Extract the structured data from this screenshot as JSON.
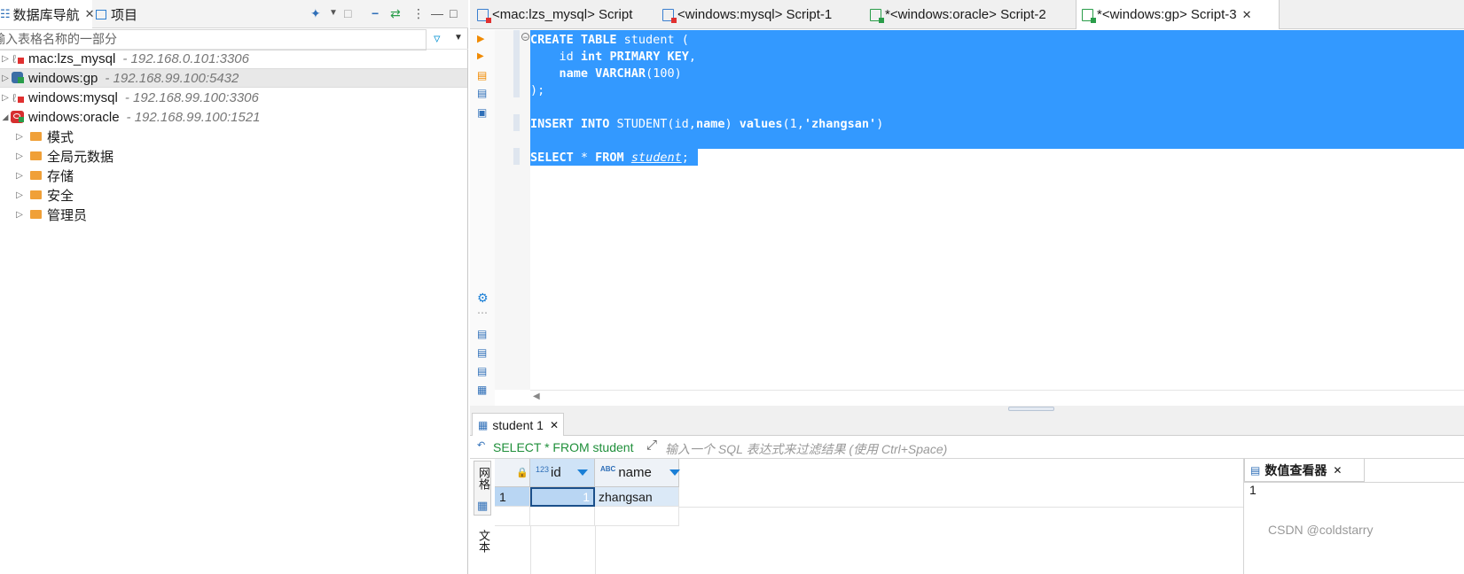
{
  "nav": {
    "tab_db": "数据库导航",
    "tab_project": "项目",
    "filter_placeholder": "输入表格名称的一部分",
    "connections": [
      {
        "name": "mac:lzs_mysql",
        "host": "- 192.168.0.101:3306"
      },
      {
        "name": "windows:gp",
        "host": "- 192.168.99.100:5432"
      },
      {
        "name": "windows:mysql",
        "host": "- 192.168.99.100:3306"
      },
      {
        "name": "windows:oracle",
        "host": "- 192.168.99.100:1521"
      }
    ],
    "oracle_children": [
      "模式",
      "全局元数据",
      "存储",
      "安全",
      "管理员"
    ]
  },
  "editor": {
    "tabs": [
      "<mac:lzs_mysql> Script",
      "<windows:mysql> Script-1",
      "*<windows:oracle> Script-2",
      "*<windows:gp> Script-3"
    ],
    "close_glyph": "✕"
  },
  "code": {
    "l1a": "CREATE TABLE",
    "l1b": " student (",
    "l2a": "    id ",
    "l2b": "int",
    "l2c": " ",
    "l2d": "PRIMARY KEY",
    "l2e": ",",
    "l3a": "    name ",
    "l3b": "VARCHAR",
    "l3c": "(100)",
    "l4": ");",
    "l6a": "INSERT INTO",
    "l6b": " STUDENT(id,",
    "l6c": "name",
    "l6d": ") ",
    "l6e": "values",
    "l6f": "(1,",
    "l6g": "'zhangsan'",
    "l6h": ")",
    "l8a": "SELECT",
    "l8b": " * ",
    "l8c": "FROM",
    "l8d": " ",
    "l8e": "student",
    "l8f": ";"
  },
  "results": {
    "tab": "student 1",
    "query": "SELECT * FROM student",
    "filter_placeholder": "输入一个 SQL 表达式来过滤结果 (使用 Ctrl+Space)",
    "side_grid": "网格",
    "side_text": "文本",
    "col_id_type": "123",
    "col_id": "id",
    "col_name_type": "ABC",
    "col_name": "name",
    "row_num": "1",
    "row_id": "1",
    "row_name": "zhangsan",
    "viewer_title": "数值查看器",
    "viewer_value": "1"
  },
  "watermark": "CSDN @coldstarry",
  "colors": {
    "selection": "#3399ff",
    "accent": "#1a7fd6",
    "keyword": "#0b1a7a"
  }
}
